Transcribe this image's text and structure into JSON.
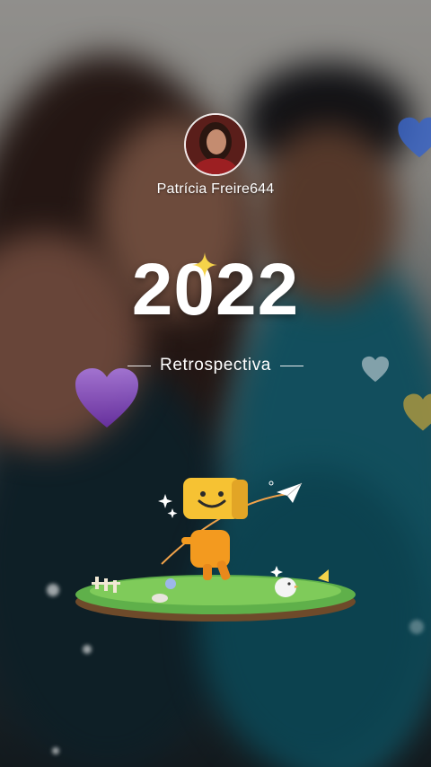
{
  "profile": {
    "username": "Patrícia Freire644"
  },
  "recap": {
    "year": "2022",
    "subtitle": "Retrospectiva"
  },
  "colors": {
    "accent_purple": "#8b4fc7",
    "accent_blue": "#3a64c4",
    "sparkle_yellow": "#f5d34a",
    "text": "#ffffff"
  },
  "icons": [
    "purple-heart-icon",
    "blue-heart-icon",
    "yellow-heart-icon",
    "sparkle-icon",
    "paper-plane-icon",
    "mascot-illustration"
  ]
}
